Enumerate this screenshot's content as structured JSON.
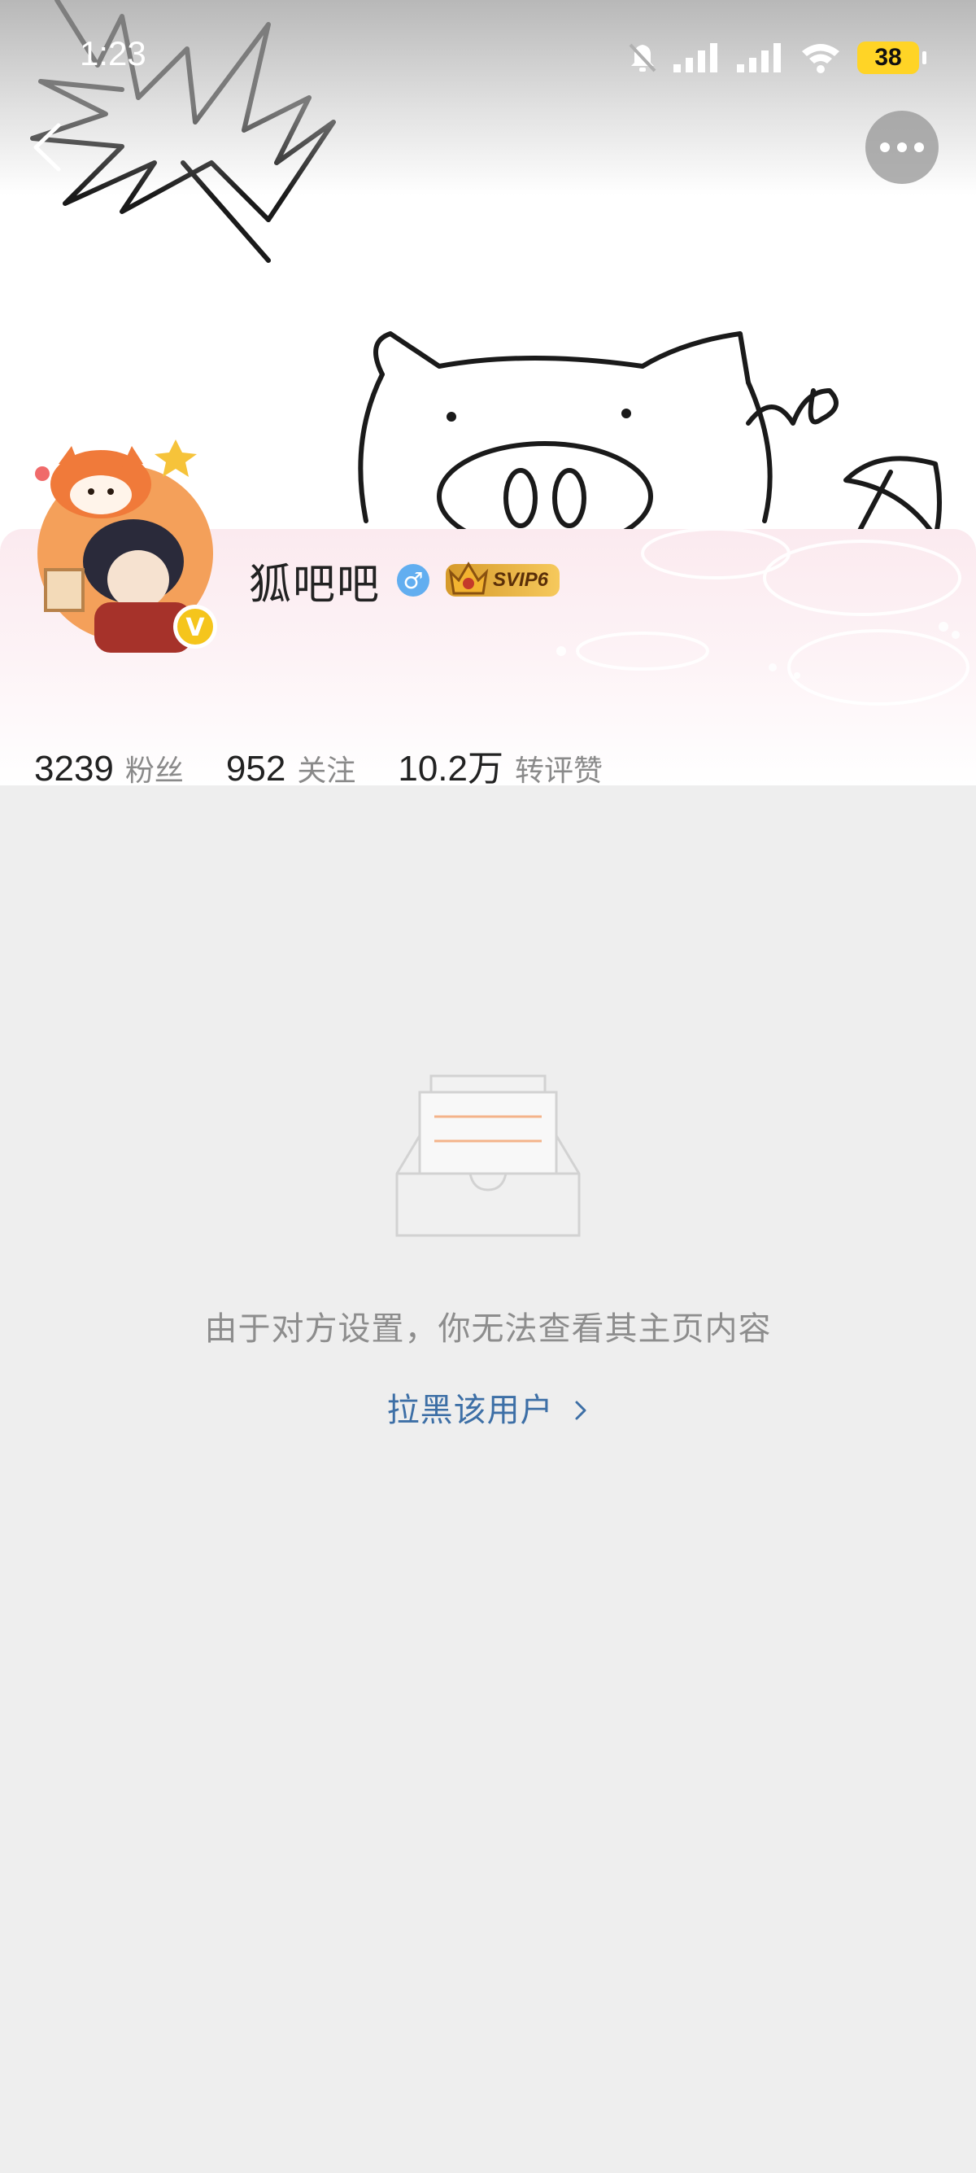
{
  "status_bar": {
    "time": "1:23",
    "battery_level": "38",
    "icons": [
      "bell-muted-icon",
      "signal-icon",
      "signal-icon",
      "wifi-icon",
      "battery-icon"
    ]
  },
  "header": {
    "back_icon": "chevron-left-icon",
    "more_icon": "more-dots-icon"
  },
  "profile": {
    "username": "狐吧吧",
    "gender_symbol": "♂",
    "vip_badge": "SVIP6",
    "verified_symbol": "V",
    "stats": [
      {
        "value": "3239",
        "label": "粉丝"
      },
      {
        "value": "952",
        "label": "关注"
      },
      {
        "value": "10.2万",
        "label": "转评赞"
      }
    ]
  },
  "empty_state": {
    "message": "由于对方设置，你无法查看其主页内容",
    "action_label": "拉黑该用户",
    "action_icon": "chevron-right-icon"
  },
  "colors": {
    "background": "#eeeeee",
    "link": "#3d6fa6",
    "battery": "#ffd426",
    "gender_badge": "#62aef0",
    "verified_badge": "#f5c51c"
  }
}
